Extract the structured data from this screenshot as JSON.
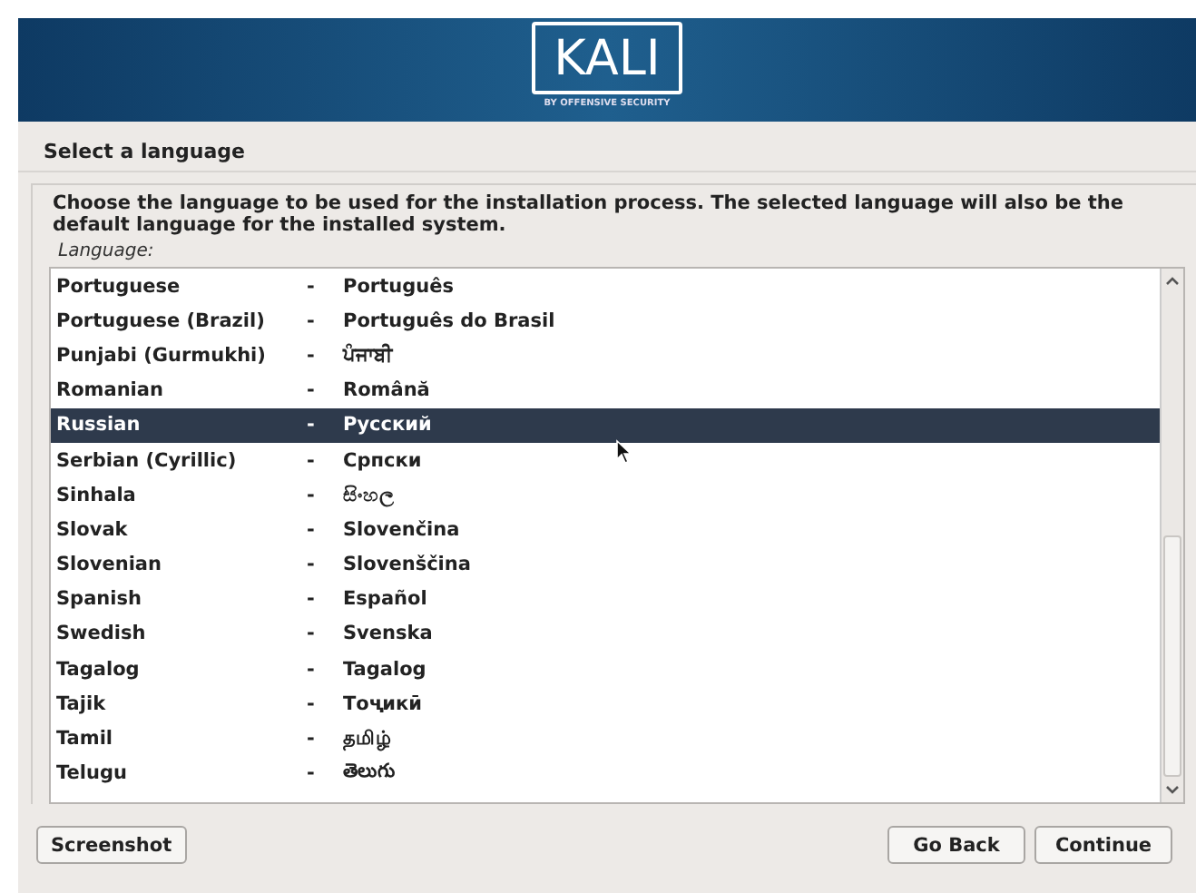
{
  "header": {
    "logo_text": "KALI",
    "logo_tagline": "BY OFFENSIVE SECURITY"
  },
  "page_title": "Select a language",
  "instructions": "Choose the language to be used for the installation process. The selected language will also be the default language for the installed system.",
  "list_label": "Language:",
  "languages": [
    {
      "name": "Portuguese",
      "separator": "-",
      "native": "Português",
      "selected": false
    },
    {
      "name": "Portuguese (Brazil)",
      "separator": "-",
      "native": "Português do Brasil",
      "selected": false
    },
    {
      "name": "Punjabi (Gurmukhi)",
      "separator": "-",
      "native": "ਪੰਜਾਬੀ",
      "selected": false
    },
    {
      "name": "Romanian",
      "separator": "-",
      "native": "Română",
      "selected": false
    },
    {
      "name": "Russian",
      "separator": "-",
      "native": "Русский",
      "selected": true
    },
    {
      "name": "Serbian (Cyrillic)",
      "separator": "-",
      "native": "Српски",
      "selected": false
    },
    {
      "name": "Sinhala",
      "separator": "-",
      "native": "සිංහල",
      "selected": false
    },
    {
      "name": "Slovak",
      "separator": "-",
      "native": "Slovenčina",
      "selected": false
    },
    {
      "name": "Slovenian",
      "separator": "-",
      "native": "Slovenščina",
      "selected": false
    },
    {
      "name": "Spanish",
      "separator": "-",
      "native": "Español",
      "selected": false
    },
    {
      "name": "Swedish",
      "separator": "-",
      "native": "Svenska",
      "selected": false
    },
    {
      "name": "Tagalog",
      "separator": "-",
      "native": "Tagalog",
      "selected": false
    },
    {
      "name": "Tajik",
      "separator": "-",
      "native": "Тоҷикӣ",
      "selected": false
    },
    {
      "name": "Tamil",
      "separator": "-",
      "native": "தமிழ்",
      "selected": false
    },
    {
      "name": "Telugu",
      "separator": "-",
      "native": "తెలుగు",
      "selected": false
    }
  ],
  "buttons": {
    "left": [
      "Screenshot"
    ],
    "right": [
      "Go Back",
      "Continue"
    ]
  }
}
